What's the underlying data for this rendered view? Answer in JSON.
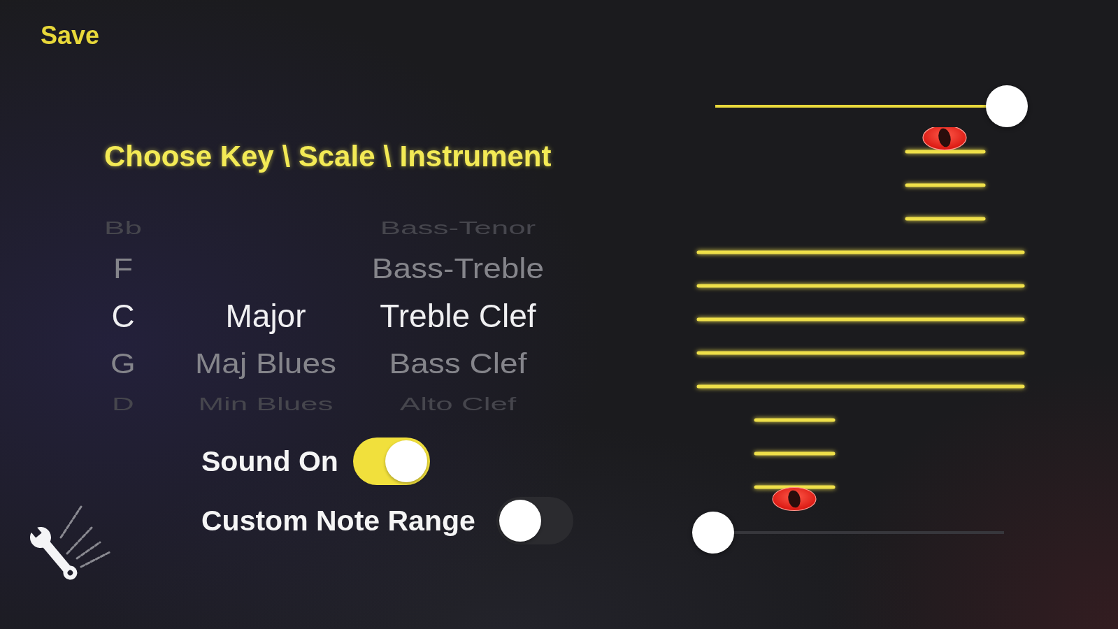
{
  "save_button": {
    "label": "Save"
  },
  "title": "Choose Key \\ Scale \\ Instrument",
  "picker_columns": [
    {
      "items": [
        {
          "label": "Bb",
          "selected": false
        },
        {
          "label": "F",
          "selected": false
        },
        {
          "label": "C",
          "selected": true
        },
        {
          "label": "G",
          "selected": false
        },
        {
          "label": "D",
          "selected": false
        }
      ]
    },
    {
      "items": [
        {
          "label": "Major",
          "selected": true
        },
        {
          "label": "Maj Blues",
          "selected": false
        },
        {
          "label": "Min Blues",
          "selected": false
        }
      ]
    },
    {
      "items": [
        {
          "label": "Bass-Tenor",
          "selected": false
        },
        {
          "label": "Bass-Treble",
          "selected": false
        },
        {
          "label": "Treble Clef",
          "selected": true
        },
        {
          "label": "Bass Clef",
          "selected": false
        },
        {
          "label": "Alto Clef",
          "selected": false
        }
      ]
    }
  ],
  "toggles": [
    {
      "label": "Sound On",
      "on": true
    },
    {
      "label": "Custom Note Range",
      "on": false
    }
  ],
  "note_range": {
    "upper_slider": {
      "level": 1
    },
    "lower_slider": {
      "level": 0
    }
  }
}
